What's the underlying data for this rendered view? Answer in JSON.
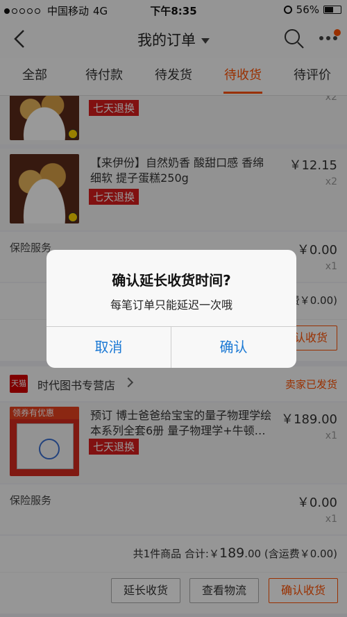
{
  "status_bar": {
    "carrier": "中国移动",
    "network": "4G",
    "time": "下午8:35",
    "battery": "56%",
    "battery_level": 0.56
  },
  "nav": {
    "title": "我的订单",
    "icons": [
      "back-icon",
      "search-icon",
      "more-icon"
    ]
  },
  "tabs": [
    "全部",
    "待付款",
    "待发货",
    "待收货",
    "待评价"
  ],
  "active_tab": "待收货",
  "order1": {
    "item_partial": {
      "refund_tag": "七天退换",
      "qty": "x2"
    },
    "item": {
      "title": "【来伊份】自然奶香 酸甜口感 香绵细软 提子蛋糕250g",
      "refund_tag": "七天退换",
      "price": "￥12.15",
      "qty": "x2"
    },
    "insurance": {
      "label": "保险服务",
      "price": "￥0.00",
      "qty": "x1"
    },
    "summary_partial": "费￥0.00)",
    "confirm_partial": "认收货"
  },
  "order2": {
    "shop_badge": "天猫",
    "shop_name": "时代图书专营店",
    "status": "卖家已发货",
    "item": {
      "thumb_label": "领券有优惠",
      "title": "预订 博士爸爸给宝宝的量子物理学绘本系列全套6册 量子物理学+牛顿…",
      "refund_tag": "七天退换",
      "price": "￥189.00",
      "qty": "x1"
    },
    "insurance": {
      "label": "保险服务",
      "price": "￥0.00",
      "qty": "x1"
    },
    "summary": {
      "prefix": "共1件商品 合计:￥",
      "amount": "189",
      "decimals": ".00",
      "shipping": "(含运费￥0.00)"
    },
    "buttons": {
      "extend": "延长收货",
      "logistics": "查看物流",
      "confirm": "确认收货"
    }
  },
  "dialog": {
    "title": "确认延长收货时间?",
    "message": "每笔订单只能延迟一次哦",
    "cancel": "取消",
    "confirm": "确认"
  }
}
